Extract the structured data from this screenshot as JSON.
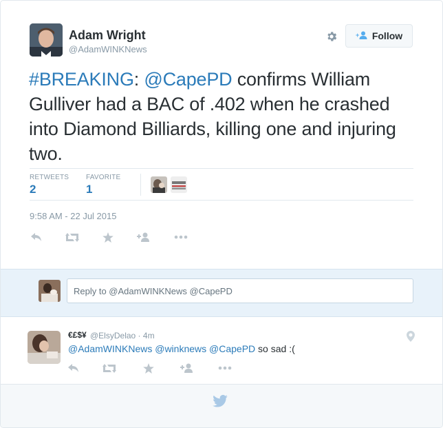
{
  "author": {
    "name": "Adam Wright",
    "handle": "@AdamWINKNews"
  },
  "follow_label": "Follow",
  "tweet": {
    "hashtag": "#BREAKING",
    "colon": ": ",
    "mention": "@CapePD",
    "body": " confirms William Gulliver had a BAC of .402 when he crashed into Diamond Billiards, killing one and injuring two."
  },
  "stats": {
    "retweets_label": "RETWEETS",
    "retweets_value": "2",
    "favorites_label": "FAVORITE",
    "favorites_value": "1"
  },
  "timestamp": "9:58 AM - 22 Jul 2015",
  "reply_placeholder": "Reply to @AdamWINKNews @CapePD",
  "reply_tweet": {
    "name": "€£$¥",
    "handle": "@ElsyDelao",
    "separator": " · ",
    "age": "4m",
    "mention1": "@AdamWINKNews",
    "mention2": "@winknews",
    "mention3": "@CapePD",
    "text": " so sad :("
  },
  "icons": {
    "settings": "gear-icon",
    "follow": "add-person-icon",
    "reply": "reply-icon",
    "retweet": "retweet-icon",
    "favorite": "star-icon",
    "more": "ellipsis-icon",
    "location": "location-pin-icon",
    "brand": "twitter-bird-icon"
  },
  "colors": {
    "link": "#2b7bb9",
    "muted": "#8899a6",
    "brand": "#55acee"
  }
}
